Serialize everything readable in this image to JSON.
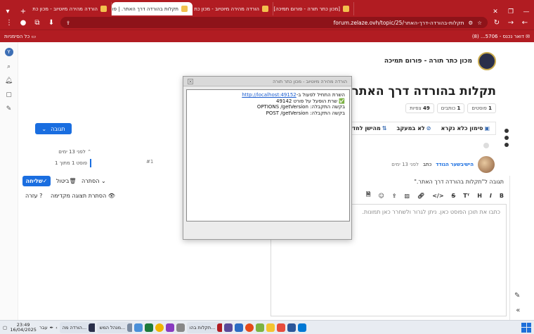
{
  "browser": {
    "tabs": [
      {
        "label": "הורדה מהירה מיוטיוב - מכון כת",
        "active": false
      },
      {
        "label": "תקלות בהורדה דרך האתר. | פו",
        "active": true
      },
      {
        "label": "הורדה מהירה מיוטיוב - מכון כת",
        "active": false
      },
      {
        "label": "[מכון כתר תורה - פורום תמיכה]",
        "active": false
      }
    ],
    "new_tab": "+",
    "url": "forum.zelaze.ovh/topic/25/תקלות-בהורדה-דרך-האתר",
    "bookmarks": [
      {
        "label": "דואר נכנס - 5706... (8)"
      }
    ],
    "all_bookmarks": "כל הסימניות"
  },
  "site": {
    "title": "מכון כתר תורה - פורום תמיכה"
  },
  "topic": {
    "title": "תקלות בהורדה דרך האתר.",
    "stats": [
      {
        "value": "1",
        "label": "פוסטים"
      },
      {
        "value": "1",
        "label": "כותבים"
      },
      {
        "value": "49",
        "label": "צפיות"
      }
    ],
    "actions": [
      {
        "label": "סימון כלא נקרא",
        "icon": "inbox-icon"
      },
      {
        "label": "לא במעקב",
        "icon": "bell-off-icon"
      },
      {
        "label": "מהישן לחדש",
        "icon": "sort-icon"
      }
    ],
    "reply_button": "תגובה"
  },
  "post": {
    "author": "הישיבשער הגודד",
    "written": "כתב",
    "time": "לפני 13 ימים",
    "number": "#1"
  },
  "timeline": {
    "time": "לפני 13 ימים",
    "position": "פוסט 1 מתוך 1"
  },
  "composer": {
    "title": "תגובה ל\"תקלות בהורדה דרך האתר.\"",
    "placeholder": "כתבו את תוכן הפוסט כאן. ניתן לגרור ולשחרר כאן תמונות.",
    "send": "שליחה",
    "cancel": "ביטול",
    "hide": "הסתרה",
    "hide_preview": "הסתרת תצוגה מקדימה",
    "help": "עזרה",
    "toolbar": [
      "B",
      "I",
      "H",
      "T",
      "S",
      "</>",
      "link",
      "img",
      "up",
      "emoji",
      "file"
    ]
  },
  "popup": {
    "title": "הורדה מהירה מיוטיוב - מכון כתר תורה",
    "lines": [
      {
        "prefix": "השרת התחיל לפעול ב-",
        "link": "http://localhost:49152"
      },
      {
        "prefix": "✅ שרת הופעל על פורט 49142"
      },
      {
        "prefix": "בקשה התקבלה: OPTIONS /getVersion"
      },
      {
        "prefix": "בקשה התקבלה: POST /getVersion"
      }
    ]
  },
  "taskbar": {
    "time": "23:49",
    "date": "16/04/2025",
    "lang": "עבר",
    "items": [
      {
        "label": "הורדה מה...",
        "color": "#2a2f4a"
      },
      {
        "label": "מנהל המש...",
        "color": "#7a8aa0"
      },
      {
        "label": "תקלות בהו...",
        "color": "#b11c22"
      }
    ]
  }
}
